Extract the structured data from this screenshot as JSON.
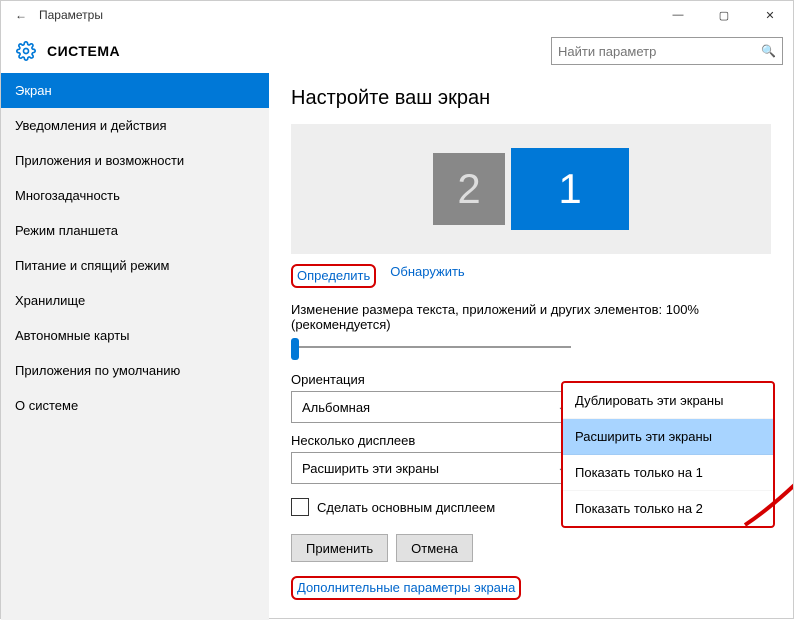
{
  "titlebar": {
    "title": "Параметры"
  },
  "header": {
    "title": "СИСТЕМА",
    "search_placeholder": "Найти параметр"
  },
  "sidebar": {
    "items": [
      "Экран",
      "Уведомления и действия",
      "Приложения и возможности",
      "Многозадачность",
      "Режим планшета",
      "Питание и спящий режим",
      "Хранилище",
      "Автономные карты",
      "Приложения по умолчанию",
      "О системе"
    ],
    "active_index": 0
  },
  "content": {
    "heading": "Настройте ваш экран",
    "displays": [
      {
        "num": "2",
        "cls": "d2"
      },
      {
        "num": "1",
        "cls": "d1"
      }
    ],
    "identify_label": "Определить",
    "detect_label": "Обнаружить",
    "scale_label": "Изменение размера текста, приложений и других элементов: 100% (рекомендуется)",
    "orientation_label": "Ориентация",
    "orientation_value": "Альбомная",
    "multidisplay_label": "Несколько дисплеев",
    "multidisplay_value": "Расширить эти экраны",
    "make_primary_label": "Сделать основным дисплеем",
    "apply_label": "Применить",
    "cancel_label": "Отмена",
    "advanced_label": "Дополнительные параметры экрана"
  },
  "popup": {
    "options": [
      "Дублировать эти экраны",
      "Расширить эти экраны",
      "Показать только на 1",
      "Показать только на 2"
    ],
    "selected_index": 1
  }
}
